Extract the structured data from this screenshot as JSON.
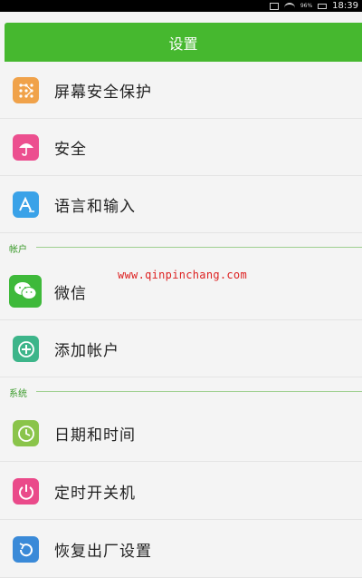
{
  "status_bar": {
    "battery_text": "96%",
    "time": "18:39",
    "icons": [
      "image-icon",
      "wifi-icon",
      "battery-icon"
    ]
  },
  "header": {
    "title": "设置"
  },
  "items_top": [
    {
      "label": "屏幕安全保护",
      "icon": "grid-lock-icon",
      "color": "#f0a24a"
    },
    {
      "label": "安全",
      "icon": "umbrella-icon",
      "color": "#ec4f8f"
    },
    {
      "label": "语言和输入",
      "icon": "language-a-icon",
      "color": "#3aa2e8"
    }
  ],
  "section_accounts": {
    "label": "帐户"
  },
  "items_accounts": [
    {
      "label": "微信",
      "icon": "wechat-icon",
      "color": "#3eb93a"
    },
    {
      "label": "添加帐户",
      "icon": "plus-circle-icon",
      "color": "#3db58a"
    }
  ],
  "section_system": {
    "label": "系统"
  },
  "items_system": [
    {
      "label": "日期和时间",
      "icon": "clock-icon",
      "color": "#8ac44a"
    },
    {
      "label": "定时开关机",
      "icon": "power-icon",
      "color": "#ea4a8a"
    },
    {
      "label": "恢复出厂设置",
      "icon": "restore-icon",
      "color": "#3a8ad8"
    }
  ],
  "watermark": "www.qinpinchang.com"
}
